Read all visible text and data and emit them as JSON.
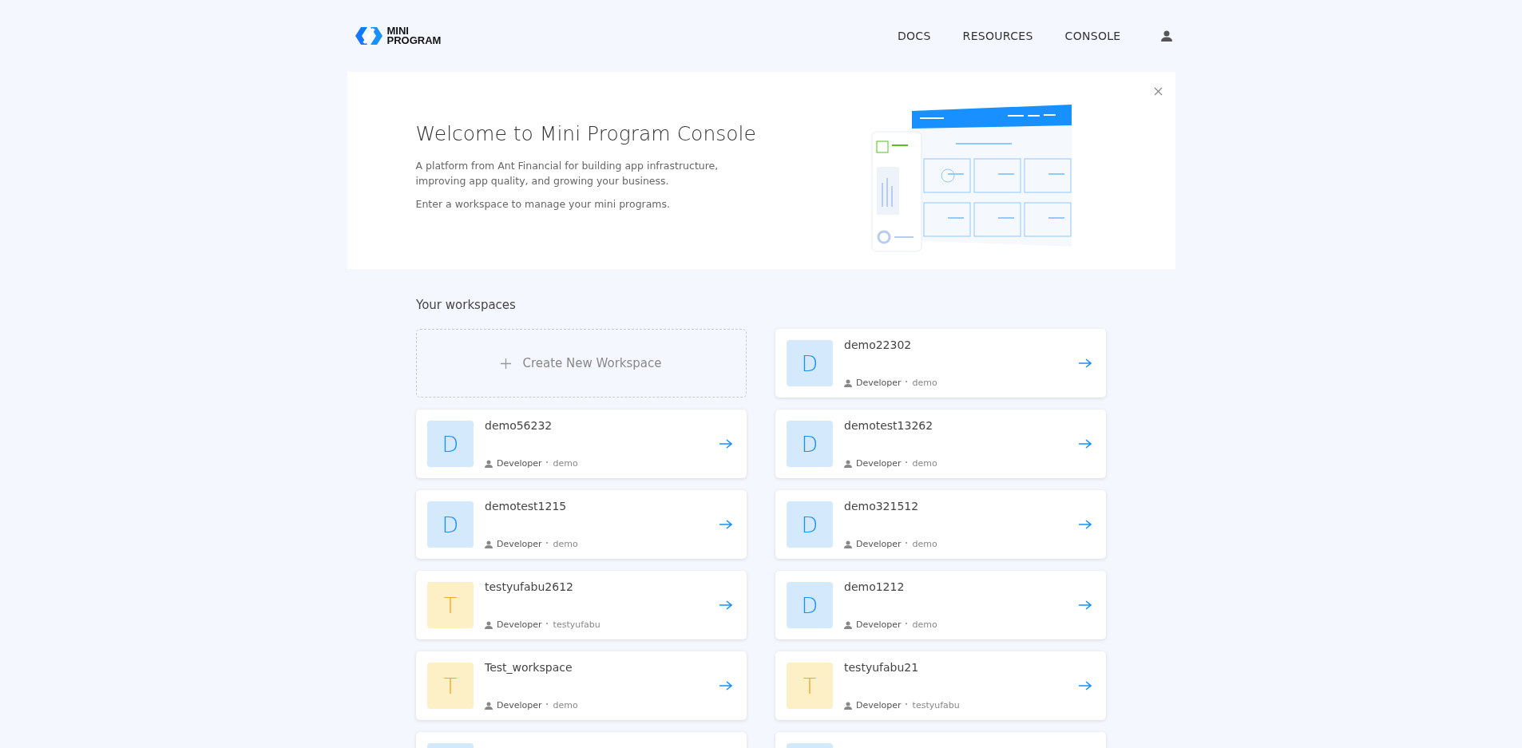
{
  "header": {
    "logo": [
      "MINI",
      "PROGRAM"
    ],
    "nav": [
      {
        "label": "DOCS"
      },
      {
        "label": "RESOURCES"
      },
      {
        "label": "CONSOLE"
      }
    ]
  },
  "banner": {
    "title": "Welcome to Mini Program Console",
    "paragraphs": [
      "A platform from Ant Financial for building app infrastructure, improving app quality, and growing your business.",
      "Enter a workspace to manage your mini programs."
    ]
  },
  "workspaces": {
    "heading": "Your workspaces",
    "create_label": "Create New Workspace",
    "items": [
      {
        "initial": "D",
        "color": "#d4eafc",
        "name": "demo22302",
        "role": "Developer",
        "owner": "demo"
      },
      {
        "initial": "D",
        "color": "#d4eafc",
        "name": "demo56232",
        "role": "Developer",
        "owner": "demo"
      },
      {
        "initial": "D",
        "color": "#d4eafc",
        "name": "demotest13262",
        "role": "Developer",
        "owner": "demo"
      },
      {
        "initial": "D",
        "color": "#d4eafc",
        "name": "demotest1215",
        "role": "Developer",
        "owner": "demo"
      },
      {
        "initial": "D",
        "color": "#d4eafc",
        "name": "demo321512",
        "role": "Developer",
        "owner": "demo"
      },
      {
        "initial": "T",
        "color": "#fdefc6",
        "name": "testyufabu2612",
        "role": "Developer",
        "owner": "testyufabu"
      },
      {
        "initial": "D",
        "color": "#d4eafc",
        "name": "demo1212",
        "role": "Developer",
        "owner": "demo"
      },
      {
        "initial": "T",
        "color": "#fdefc6",
        "name": "Test_workspace",
        "role": "Developer",
        "owner": "demo"
      },
      {
        "initial": "T",
        "color": "#fdefc6",
        "name": "testyufabu21",
        "role": "Developer",
        "owner": "testyufabu"
      },
      {
        "color": "#d4eafc"
      },
      {
        "color": "#d4eafc"
      }
    ]
  }
}
